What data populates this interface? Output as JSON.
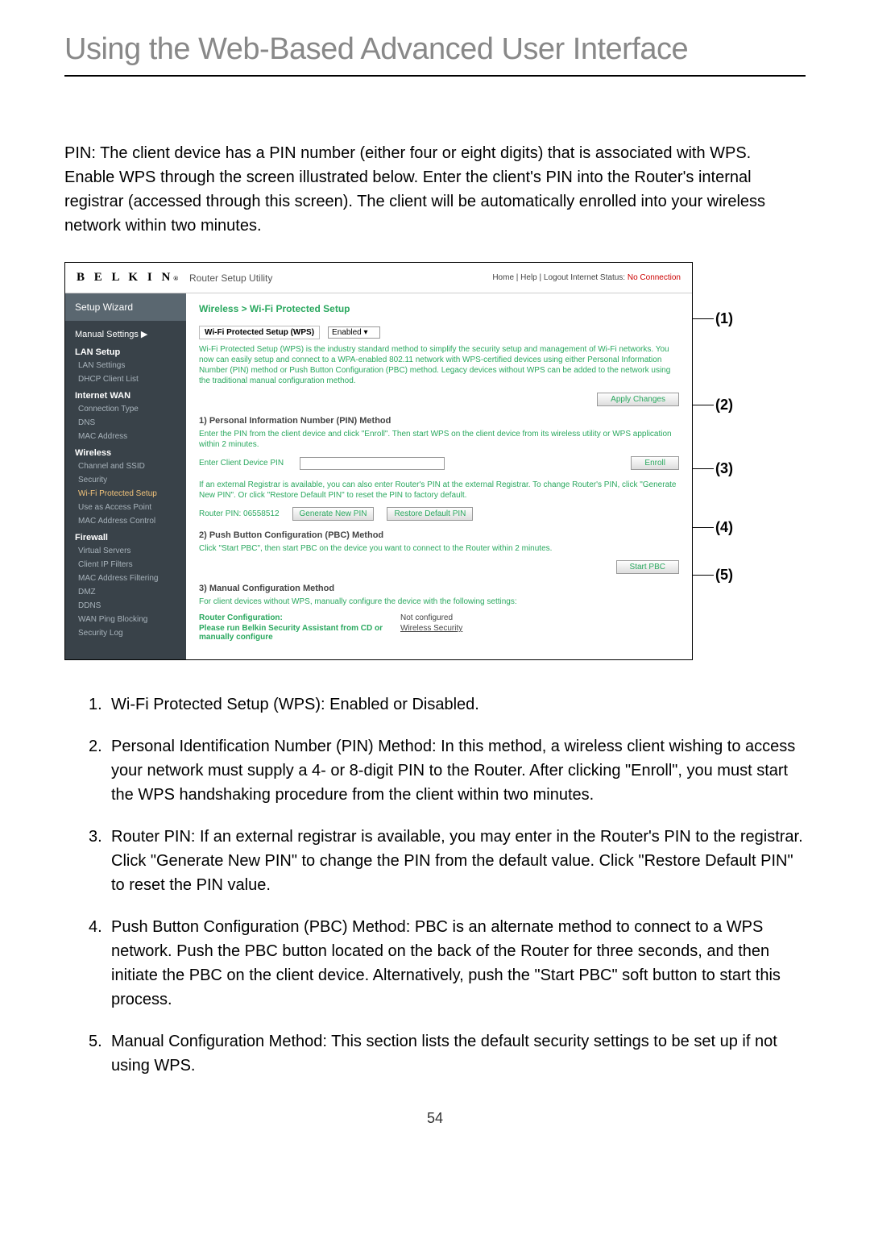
{
  "page_title": "Using the Web-Based Advanced User Interface",
  "intro": "PIN: The client device has a PIN number (either four or eight digits) that is associated with WPS. Enable WPS through the screen illustrated below. Enter the client's PIN into the Router's internal registrar (accessed through this screen). The client will be automatically enrolled into your wireless network within two minutes.",
  "page_number": "54",
  "screenshot": {
    "brand": "B E L K I N",
    "brand_r": "®",
    "util_title": "Router Setup Utility",
    "toplinks_prefix": "Home | Help | Logout   Internet Status: ",
    "toplinks_status": "No Connection",
    "sidebar": {
      "setup_wizard": "Setup Wizard",
      "manual_settings": "Manual Settings ▶",
      "lan_header": "LAN Setup",
      "lan_items": [
        "LAN Settings",
        "DHCP Client List"
      ],
      "wan_header": "Internet WAN",
      "wan_items": [
        "Connection Type",
        "DNS",
        "MAC Address"
      ],
      "wireless_header": "Wireless",
      "wireless_items": [
        "Channel and SSID",
        "Security",
        "Wi-Fi Protected Setup",
        "Use as Access Point",
        "MAC Address Control"
      ],
      "firewall_header": "Firewall",
      "firewall_items": [
        "Virtual Servers",
        "Client IP Filters",
        "MAC Address Filtering",
        "DMZ",
        "DDNS",
        "WAN Ping Blocking",
        "Security Log"
      ]
    },
    "content": {
      "breadcrumb": "Wireless > Wi-Fi Protected Setup",
      "wps_label": "Wi-Fi Protected Setup (WPS)",
      "wps_value": "Enabled ▾",
      "wps_desc": "Wi-Fi Protected Setup (WPS) is the industry standard method to simplify the security setup and management of Wi-Fi networks. You now can easily setup and connect to a WPA-enabled 802.11 network with WPS-certified devices using either Personal Information Number (PIN) method or Push Button Configuration (PBC) method. Legacy devices without WPS can be added to the network using the traditional manual configuration method.",
      "apply_changes": "Apply Changes",
      "sec1_title": "1) Personal Information Number (PIN) Method",
      "sec1_desc": "Enter the PIN from the client device and click \"Enroll\". Then start WPS on the client device from its wireless utility or WPS application within 2 minutes.",
      "pin_label": "Enter Client Device PIN",
      "pin_button": "Enroll",
      "registrar_desc": "If an external Registrar is available, you can also enter Router's PIN at the external Registrar. To change Router's PIN, click \"Generate New PIN\". Or click \"Restore Default PIN\" to reset the PIN to factory default.",
      "router_pin_label": "Router PIN:  06558512",
      "gen_pin": "Generate New PIN",
      "restore_pin": "Restore Default PIN",
      "sec2_title": "2) Push Button Configuration (PBC) Method",
      "sec2_desc": "Click \"Start PBC\", then start PBC on the device you want to connect to the Router within 2 minutes.",
      "start_pbc": "Start PBC",
      "sec3_title": "3) Manual Configuration Method",
      "sec3_desc": "For client devices without WPS, manually configure the device with the following settings:",
      "row1_k": "Router Configuration:",
      "row1_v": "Not configured",
      "row2_k": "Please run Belkin Security Assistant from CD or manually configure",
      "row2_v": "Wireless Security"
    }
  },
  "callouts": [
    "(1)",
    "(2)",
    "(3)",
    "(4)",
    "(5)"
  ],
  "list": [
    {
      "n": "1.",
      "t": "Wi-Fi Protected Setup (WPS): Enabled or Disabled."
    },
    {
      "n": "2.",
      "t": "Personal Identification Number (PIN) Method: In this method, a wireless client wishing to access your network must supply a 4- or 8-digit PIN to the Router. After clicking \"Enroll\", you must start the WPS handshaking procedure from the client within two minutes."
    },
    {
      "n": "3.",
      "t": "Router PIN: If an external registrar is available, you may enter in the Router's PIN to the registrar. Click \"Generate New PIN\" to change the PIN from the default value. Click \"Restore Default PIN\" to reset the PIN value."
    },
    {
      "n": "4.",
      "t": "Push Button Configuration (PBC) Method: PBC is an alternate method to connect to a WPS network. Push the PBC button located on the back of the Router for three seconds, and then initiate the PBC on the client device. Alternatively, push the \"Start PBC\" soft button to start this process."
    },
    {
      "n": "5.",
      "t": "Manual Configuration Method: This section lists the default security settings to be set up if not using WPS."
    }
  ]
}
